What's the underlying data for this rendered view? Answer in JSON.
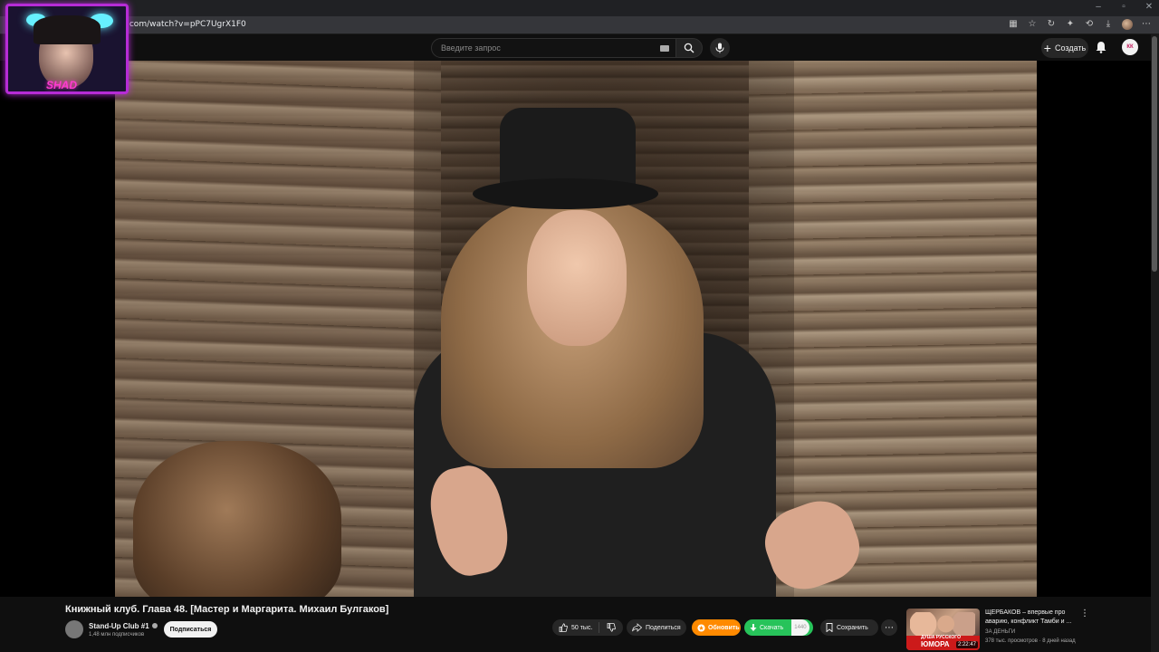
{
  "browser": {
    "url": ".com/watch?v=pPC7UgrX1F0",
    "window_controls": [
      "–",
      "▫",
      "✕"
    ],
    "extension_icons": [
      "apps-icon",
      "star-icon",
      "refresh-icon",
      "extension-icon",
      "history-icon",
      "download-icon",
      "profile-avatar",
      "menu-icon"
    ]
  },
  "header": {
    "search_placeholder": "Введите запрос",
    "create_label": "Создать",
    "avatar_initials": "КК"
  },
  "overlay": {
    "logo_text": "SHAD"
  },
  "video": {
    "title": "Книжный клуб. Глава 48. [Мастер и Маргарита. Михаил Булгаков]",
    "channel_name": "Stand-Up Club #1",
    "subscribers": "1,48 млн подписчиков",
    "subscribe_label": "Подписаться",
    "likes": "50 тыс.",
    "share_label": "Поделиться",
    "update_label": "Обновить",
    "download_label": "Скачать",
    "download_count": "1440",
    "save_label": "Сохранить"
  },
  "recommendation": {
    "title": "ЩЕРБАКОВ – впервые про аварию, конфликт Тамби и ...",
    "channel": "ЗА ДЕНЬГИ",
    "meta": "378 тыс. просмотров · 8 дней назад",
    "duration": "2:22:47",
    "thumb_line1": "ДУША РУССКОГО",
    "thumb_line2": "ЮМОРА"
  },
  "colors": {
    "update_orange": "#ff8a00",
    "download_green": "#27c35a",
    "overlay_purple": "#b62cd6"
  }
}
